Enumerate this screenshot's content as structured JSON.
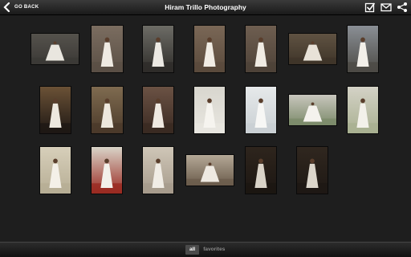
{
  "header": {
    "back_label": "GO BACK",
    "title": "Hiram Trillo Photography",
    "icons": [
      "checkbox-icon",
      "mail-icon",
      "share-icon"
    ]
  },
  "gallery": {
    "photos": [
      {
        "id": "p1",
        "tone": "#3b3936",
        "bg": "#55524c",
        "fig": "#e9e6df"
      },
      {
        "id": "p2",
        "tone": "#5a4f45",
        "bg": "#7b6d60",
        "fig": "#efeae2"
      },
      {
        "id": "p3",
        "tone": "#2e2c29",
        "bg": "#6d6c66",
        "fig": "#ece9e3"
      },
      {
        "id": "p4",
        "tone": "#5a4a3c",
        "bg": "#7a6756",
        "fig": "#f1ece4"
      },
      {
        "id": "p5",
        "tone": "#4e4238",
        "bg": "#6e5e50",
        "fig": "#f0ebe3"
      },
      {
        "id": "p6",
        "tone": "#3f3529",
        "bg": "#5f5242",
        "fig": "#e8e2d8"
      },
      {
        "id": "p7",
        "tone": "#4c4a45",
        "bg": "#8a8f95",
        "fig": "#f2efe9"
      },
      {
        "id": "p8",
        "tone": "#1e1814",
        "bg": "#6b5236",
        "fig": "#ede8df"
      },
      {
        "id": "p9",
        "tone": "#4b3a2a",
        "bg": "#7f6b50",
        "fig": "#ede7dd"
      },
      {
        "id": "p10",
        "tone": "#3a2a22",
        "bg": "#6b5244",
        "fig": "#efe9e1"
      },
      {
        "id": "p11",
        "tone": "#e8e6e0",
        "bg": "#d8d6ce",
        "fig": "#f6f4ef"
      },
      {
        "id": "p12",
        "tone": "#c9cfd3",
        "bg": "#e6e9ea",
        "fig": "#f7f7f5"
      },
      {
        "id": "p13",
        "tone": "#7c8b6a",
        "bg": "#c8c6bd",
        "fig": "#f4f2ed"
      },
      {
        "id": "p14",
        "tone": "#a9b091",
        "bg": "#d4d2c6",
        "fig": "#f3f1ea"
      },
      {
        "id": "p15",
        "tone": "#b7ae95",
        "bg": "#d7cfba",
        "fig": "#f4f0e8"
      },
      {
        "id": "p16",
        "tone": "#9a2a22",
        "bg": "#d9d4c8",
        "fig": "#f3f0ea"
      },
      {
        "id": "p17",
        "tone": "#a69b8c",
        "bg": "#cfc6b7",
        "fig": "#f1ede6"
      },
      {
        "id": "p18",
        "tone": "#6b5c4c",
        "bg": "#b4a896",
        "fig": "#eee9e1"
      },
      {
        "id": "p19",
        "tone": "#1c1612",
        "bg": "#2e251d",
        "fig": "#d9d3c8"
      },
      {
        "id": "p20",
        "tone": "#1e1814",
        "bg": "#30271f",
        "fig": "#dcd6cb"
      }
    ]
  },
  "footer": {
    "tabs": [
      {
        "label": "all",
        "active": true
      },
      {
        "label": "favorites",
        "active": false
      }
    ]
  }
}
